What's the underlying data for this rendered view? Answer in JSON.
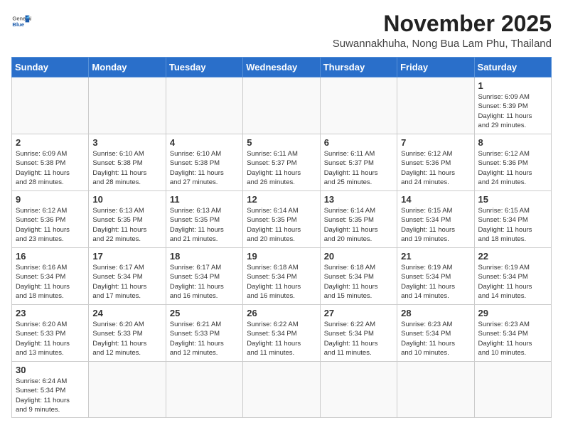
{
  "header": {
    "logo_general": "General",
    "logo_blue": "Blue",
    "month": "November 2025",
    "location": "Suwannakhuha, Nong Bua Lam Phu, Thailand"
  },
  "weekdays": [
    "Sunday",
    "Monday",
    "Tuesday",
    "Wednesday",
    "Thursday",
    "Friday",
    "Saturday"
  ],
  "weeks": [
    [
      {
        "day": "",
        "info": ""
      },
      {
        "day": "",
        "info": ""
      },
      {
        "day": "",
        "info": ""
      },
      {
        "day": "",
        "info": ""
      },
      {
        "day": "",
        "info": ""
      },
      {
        "day": "",
        "info": ""
      },
      {
        "day": "1",
        "info": "Sunrise: 6:09 AM\nSunset: 5:39 PM\nDaylight: 11 hours\nand 29 minutes."
      }
    ],
    [
      {
        "day": "2",
        "info": "Sunrise: 6:09 AM\nSunset: 5:38 PM\nDaylight: 11 hours\nand 28 minutes."
      },
      {
        "day": "3",
        "info": "Sunrise: 6:10 AM\nSunset: 5:38 PM\nDaylight: 11 hours\nand 28 minutes."
      },
      {
        "day": "4",
        "info": "Sunrise: 6:10 AM\nSunset: 5:38 PM\nDaylight: 11 hours\nand 27 minutes."
      },
      {
        "day": "5",
        "info": "Sunrise: 6:11 AM\nSunset: 5:37 PM\nDaylight: 11 hours\nand 26 minutes."
      },
      {
        "day": "6",
        "info": "Sunrise: 6:11 AM\nSunset: 5:37 PM\nDaylight: 11 hours\nand 25 minutes."
      },
      {
        "day": "7",
        "info": "Sunrise: 6:12 AM\nSunset: 5:36 PM\nDaylight: 11 hours\nand 24 minutes."
      },
      {
        "day": "8",
        "info": "Sunrise: 6:12 AM\nSunset: 5:36 PM\nDaylight: 11 hours\nand 24 minutes."
      }
    ],
    [
      {
        "day": "9",
        "info": "Sunrise: 6:12 AM\nSunset: 5:36 PM\nDaylight: 11 hours\nand 23 minutes."
      },
      {
        "day": "10",
        "info": "Sunrise: 6:13 AM\nSunset: 5:35 PM\nDaylight: 11 hours\nand 22 minutes."
      },
      {
        "day": "11",
        "info": "Sunrise: 6:13 AM\nSunset: 5:35 PM\nDaylight: 11 hours\nand 21 minutes."
      },
      {
        "day": "12",
        "info": "Sunrise: 6:14 AM\nSunset: 5:35 PM\nDaylight: 11 hours\nand 20 minutes."
      },
      {
        "day": "13",
        "info": "Sunrise: 6:14 AM\nSunset: 5:35 PM\nDaylight: 11 hours\nand 20 minutes."
      },
      {
        "day": "14",
        "info": "Sunrise: 6:15 AM\nSunset: 5:34 PM\nDaylight: 11 hours\nand 19 minutes."
      },
      {
        "day": "15",
        "info": "Sunrise: 6:15 AM\nSunset: 5:34 PM\nDaylight: 11 hours\nand 18 minutes."
      }
    ],
    [
      {
        "day": "16",
        "info": "Sunrise: 6:16 AM\nSunset: 5:34 PM\nDaylight: 11 hours\nand 18 minutes."
      },
      {
        "day": "17",
        "info": "Sunrise: 6:17 AM\nSunset: 5:34 PM\nDaylight: 11 hours\nand 17 minutes."
      },
      {
        "day": "18",
        "info": "Sunrise: 6:17 AM\nSunset: 5:34 PM\nDaylight: 11 hours\nand 16 minutes."
      },
      {
        "day": "19",
        "info": "Sunrise: 6:18 AM\nSunset: 5:34 PM\nDaylight: 11 hours\nand 16 minutes."
      },
      {
        "day": "20",
        "info": "Sunrise: 6:18 AM\nSunset: 5:34 PM\nDaylight: 11 hours\nand 15 minutes."
      },
      {
        "day": "21",
        "info": "Sunrise: 6:19 AM\nSunset: 5:34 PM\nDaylight: 11 hours\nand 14 minutes."
      },
      {
        "day": "22",
        "info": "Sunrise: 6:19 AM\nSunset: 5:34 PM\nDaylight: 11 hours\nand 14 minutes."
      }
    ],
    [
      {
        "day": "23",
        "info": "Sunrise: 6:20 AM\nSunset: 5:33 PM\nDaylight: 11 hours\nand 13 minutes."
      },
      {
        "day": "24",
        "info": "Sunrise: 6:20 AM\nSunset: 5:33 PM\nDaylight: 11 hours\nand 12 minutes."
      },
      {
        "day": "25",
        "info": "Sunrise: 6:21 AM\nSunset: 5:33 PM\nDaylight: 11 hours\nand 12 minutes."
      },
      {
        "day": "26",
        "info": "Sunrise: 6:22 AM\nSunset: 5:34 PM\nDaylight: 11 hours\nand 11 minutes."
      },
      {
        "day": "27",
        "info": "Sunrise: 6:22 AM\nSunset: 5:34 PM\nDaylight: 11 hours\nand 11 minutes."
      },
      {
        "day": "28",
        "info": "Sunrise: 6:23 AM\nSunset: 5:34 PM\nDaylight: 11 hours\nand 10 minutes."
      },
      {
        "day": "29",
        "info": "Sunrise: 6:23 AM\nSunset: 5:34 PM\nDaylight: 11 hours\nand 10 minutes."
      }
    ],
    [
      {
        "day": "30",
        "info": "Sunrise: 6:24 AM\nSunset: 5:34 PM\nDaylight: 11 hours\nand 9 minutes."
      },
      {
        "day": "",
        "info": ""
      },
      {
        "day": "",
        "info": ""
      },
      {
        "day": "",
        "info": ""
      },
      {
        "day": "",
        "info": ""
      },
      {
        "day": "",
        "info": ""
      },
      {
        "day": "",
        "info": ""
      }
    ]
  ]
}
